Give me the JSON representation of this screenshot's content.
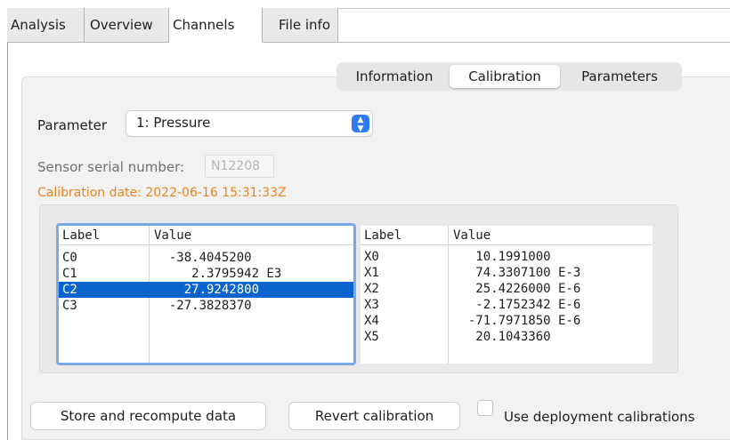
{
  "top_tabs": [
    "Analysis",
    "Overview",
    "Channels",
    "File info"
  ],
  "sub_tabs": [
    "Information",
    "Calibration",
    "Parameters"
  ],
  "parameter": {
    "label": "Parameter",
    "value": "1: Pressure"
  },
  "serial": {
    "label": "Sensor serial number:",
    "value": "N12208"
  },
  "calibration_date": "Calibration date: 2022-06-16 15:31:33Z",
  "left_table": {
    "headers": [
      "Label",
      "Value"
    ],
    "rows": [
      {
        "label": "C0",
        "value": "  -38.4045200"
      },
      {
        "label": "C1",
        "value": "     2.3795942 E3"
      },
      {
        "label": "C2",
        "value": "    27.9242800"
      },
      {
        "label": "C3",
        "value": "  -27.3828370"
      }
    ],
    "selected_row": 2
  },
  "right_table": {
    "headers": [
      "Label",
      "Value"
    ],
    "rows": [
      {
        "label": "X0",
        "value": "   10.1991000"
      },
      {
        "label": "X1",
        "value": "   74.3307100 E-3"
      },
      {
        "label": "X2",
        "value": "   25.4226000 E-6"
      },
      {
        "label": "X3",
        "value": "   -2.1752342 E-6"
      },
      {
        "label": "X4",
        "value": "  -71.7971850 E-6"
      },
      {
        "label": "X5",
        "value": "   20.1043360"
      }
    ]
  },
  "buttons": {
    "store": "Store and recompute data",
    "revert": "Revert calibration",
    "use_deployment": "Use deployment calibrations"
  },
  "colors": {
    "accent": "#2f7bf6",
    "selection": "#0b63ce",
    "focus_ring": "#7aa8e8",
    "date_text": "#e8831f"
  }
}
